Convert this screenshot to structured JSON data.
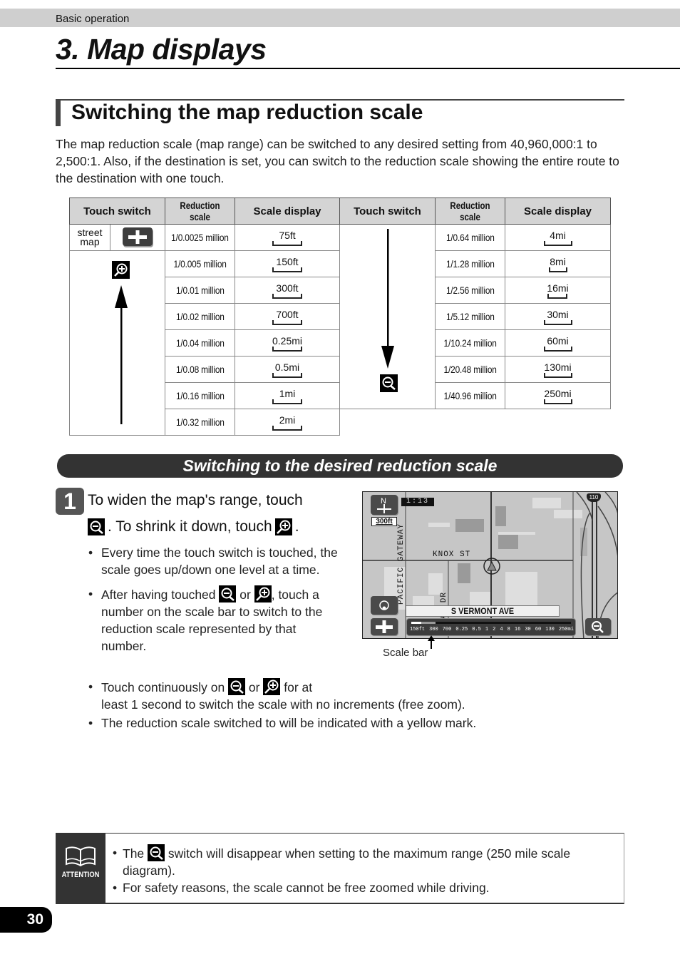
{
  "header": {
    "section_label": "Basic operation"
  },
  "chapter": {
    "title": "3. Map displays"
  },
  "section": {
    "title": "Switching the map reduction scale",
    "intro": "The map reduction scale (map range) can be switched to any desired setting from 40,960,000:1 to 2,500:1.  Also, if the destination is set, you can switch to the reduction scale showing the entire route to the destination with one touch."
  },
  "scale_table": {
    "headers": {
      "touch_switch": "Touch switch",
      "reduction_scale": "Reduction scale",
      "scale_display": "Scale display"
    },
    "street_map_label": "street map",
    "left_rows": [
      {
        "reduction": "1/0.0025 million",
        "display": "75ft"
      },
      {
        "reduction": "1/0.005 million",
        "display": "150ft"
      },
      {
        "reduction": "1/0.01 million",
        "display": "300ft"
      },
      {
        "reduction": "1/0.02 million",
        "display": "700ft"
      },
      {
        "reduction": "1/0.04 million",
        "display": "0.25mi"
      },
      {
        "reduction": "1/0.08 million",
        "display": "0.5mi"
      },
      {
        "reduction": "1/0.16 million",
        "display": "1mi"
      },
      {
        "reduction": "1/0.32 million",
        "display": "2mi"
      }
    ],
    "right_rows": [
      {
        "reduction": "1/0.64 million",
        "display": "4mi"
      },
      {
        "reduction": "1/1.28 million",
        "display": "8mi"
      },
      {
        "reduction": "1/2.56 million",
        "display": "16mi"
      },
      {
        "reduction": "1/5.12 million",
        "display": "30mi"
      },
      {
        "reduction": "1/10.24 million",
        "display": "60mi"
      },
      {
        "reduction": "1/20.48 million",
        "display": "130mi"
      },
      {
        "reduction": "1/40.96 million",
        "display": "250mi"
      }
    ]
  },
  "subsection": {
    "title": "Switching to the desired reduction scale"
  },
  "step": {
    "number": "1",
    "line1": "To widen the map's range, touch",
    "line2_a": ".  To shrink it down, touch",
    "line2_b": ".",
    "bullets": {
      "b1": "Every time the touch switch is touched, the scale goes up/down one level at a time.",
      "b2_a": "After having touched",
      "b2_or": "or",
      "b2_b": ", touch a number on the scale bar to switch to the reduction scale represented by that number.",
      "b3_a": "Touch continuously on",
      "b3_or": "or",
      "b3_b": "for at",
      "b3_c": "least 1 second to switch the scale with no increments (free zoom).",
      "b4": "The reduction scale switched to will be indicated with a yellow mark."
    }
  },
  "map_screen": {
    "time": "1:13",
    "scale_badge": "300ft",
    "highway_shield": "110",
    "street_names": [
      "KNOX ST",
      "PACIFIC GATEWAY",
      "AN DR"
    ],
    "current_street": "S VERMONT AVE",
    "scale_bar_labels": [
      "150ft",
      "300",
      "700",
      "0.25",
      "0.5",
      "1",
      "2",
      "4",
      "8",
      "16",
      "30",
      "60",
      "130",
      "250mi"
    ],
    "caption": "Scale bar"
  },
  "attention": {
    "label": "ATTENTION",
    "note1_a": "The",
    "note1_b": "switch will disappear when setting to the maximum range (250 mile scale diagram).",
    "note2": "For safety reasons, the scale cannot be free zoomed while driving."
  },
  "page_number": "30"
}
